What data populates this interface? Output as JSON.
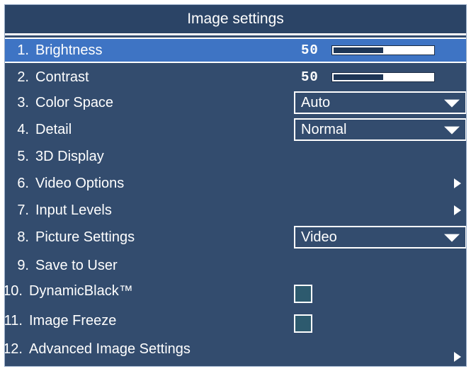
{
  "menu": {
    "title": "Image settings",
    "items": [
      {
        "num": "1.",
        "label": "Brightness",
        "value": "50",
        "level": 0.5,
        "selected": true
      },
      {
        "num": "2.",
        "label": "Contrast",
        "value": "50",
        "level": 0.5
      },
      {
        "num": "3.",
        "label": "Color Space",
        "dropdown": "Auto"
      },
      {
        "num": "4.",
        "label": "Detail",
        "dropdown": "Normal"
      },
      {
        "num": "5.",
        "label": "3D Display"
      },
      {
        "num": "6.",
        "label": "Video Options"
      },
      {
        "num": "7.",
        "label": "Input Levels"
      },
      {
        "num": "8.",
        "label": "Picture Settings",
        "dropdown": "Video"
      },
      {
        "num": "9.",
        "label": "Save to User"
      },
      {
        "num": "10.",
        "label": "DynamicBlack™",
        "checked": false
      },
      {
        "num": "11.",
        "label": "Image Freeze",
        "checked": false
      },
      {
        "num": "12.",
        "label": "Advanced Image Settings"
      }
    ]
  },
  "colors": {
    "panel": "#334c6e",
    "selected_row": "#3e74c4",
    "text": "#ffffff"
  }
}
